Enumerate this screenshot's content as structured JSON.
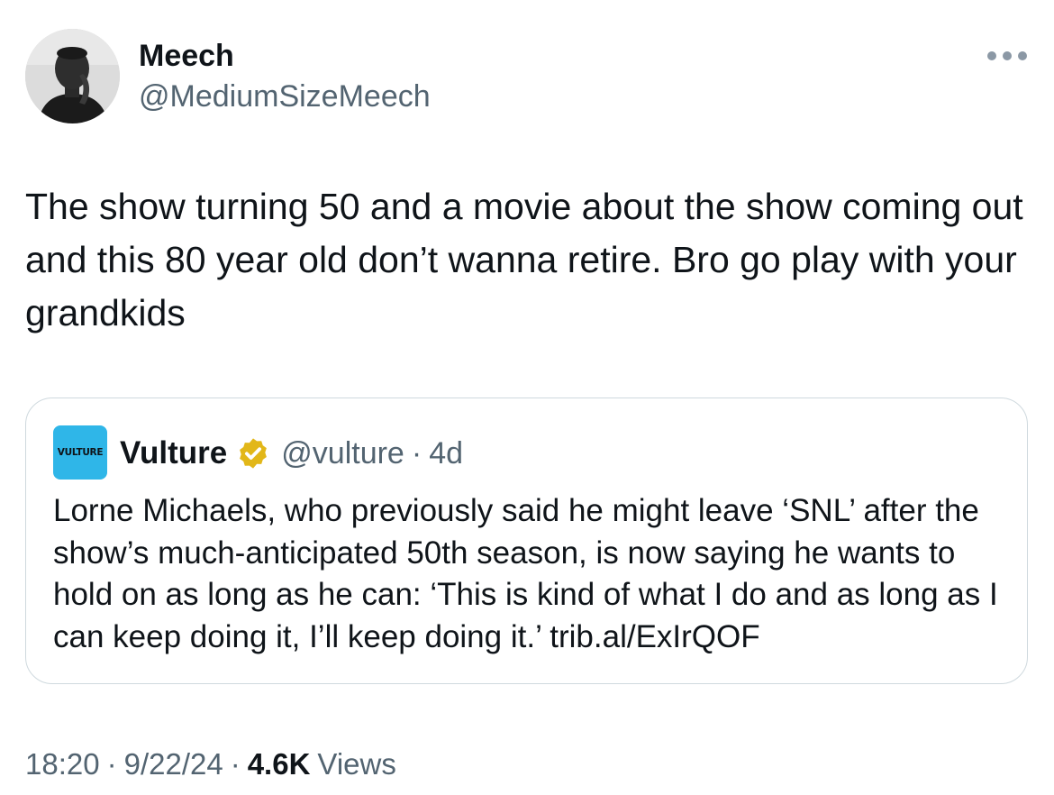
{
  "author": {
    "name": "Meech",
    "handle": "@MediumSizeMeech"
  },
  "tweet": {
    "text": "The show turning 50 and a movie about the show coming out and this 80 year old don’t wanna retire. Bro go play with your grandkids"
  },
  "quote": {
    "avatar_text": "VULTURE",
    "name": "Vulture",
    "handle": "@vulture",
    "separator": "·",
    "time": "4d",
    "text": "Lorne Michaels, who previously said he might leave ‘SNL’ after the show’s much-anticipated 50th season, is now saying he wants to hold on as long as he can: ‘This is kind of what I do and as long as I can keep doing it, I’ll keep doing it.’ trib.al/ExIrQOF"
  },
  "meta": {
    "time": "18:20",
    "date": "9/22/24",
    "separator": "·",
    "views_count": "4.6K",
    "views_label": "Views"
  },
  "icons": {
    "more": "more-horizontal-icon",
    "verified": "verified-badge-icon"
  },
  "colors": {
    "text": "#0f1419",
    "secondary": "#536471",
    "border": "#cfd9de",
    "verified_gold": "#e2b719",
    "vulture_blue": "#2fb6e8"
  }
}
